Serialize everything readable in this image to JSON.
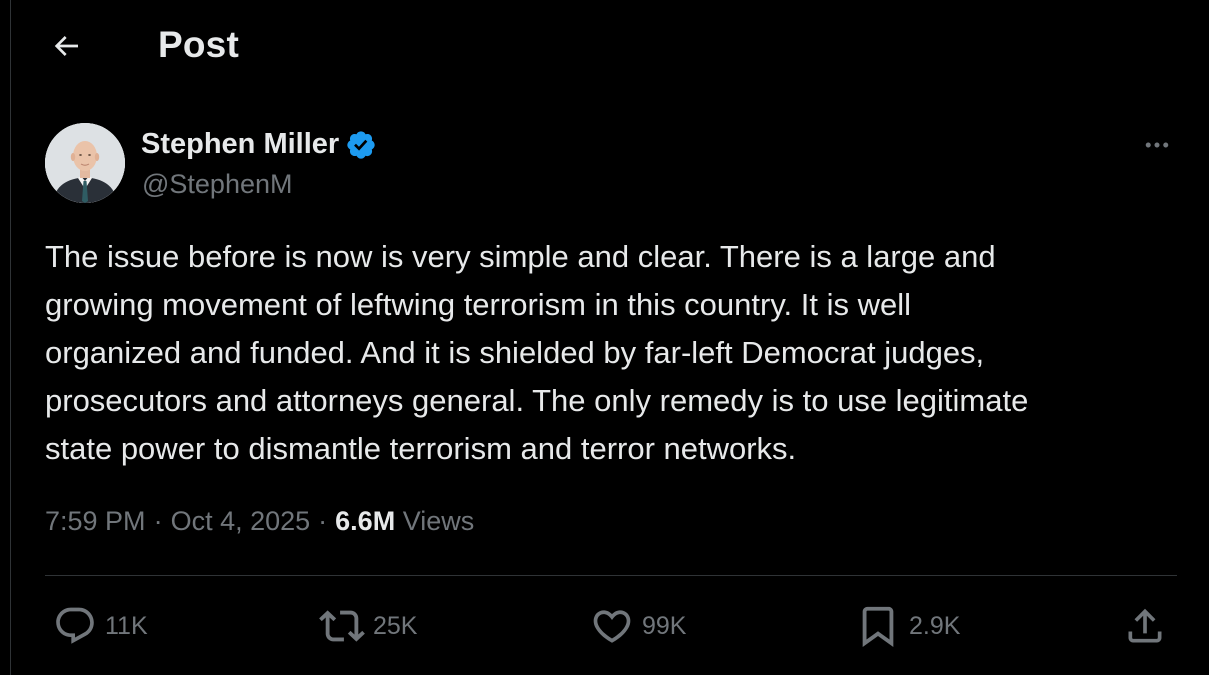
{
  "header": {
    "title": "Post"
  },
  "author": {
    "display_name": "Stephen Miller",
    "handle": "@StephenM",
    "verified": true
  },
  "post": {
    "text": "The issue before is now is very simple and clear. There is a large and\ngrowing movement of leftwing terrorism in this country. It is well\norganized and funded. And it is shielded by far-left Democrat judges,\nprosecutors and attorneys general. The only remedy is to use legitimate\nstate power to dismantle terrorism and terror networks.",
    "time": "7:59 PM",
    "date": "Oct 4, 2025",
    "separator": "·",
    "views_count": "6.6M",
    "views_label": "Views"
  },
  "actions": {
    "replies": "11K",
    "reposts": "25K",
    "likes": "99K",
    "bookmarks": "2.9K"
  },
  "colors": {
    "background": "#000000",
    "text_primary": "#e7e9ea",
    "text_secondary": "#71767b",
    "verified_badge": "#1d9bf0",
    "divider": "#2f3336"
  },
  "icons": [
    "back-arrow-icon",
    "verified-badge-icon",
    "more-icon",
    "reply-icon",
    "repost-icon",
    "like-icon",
    "bookmark-icon",
    "share-icon"
  ]
}
